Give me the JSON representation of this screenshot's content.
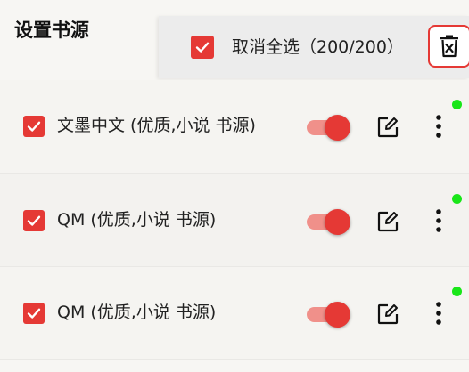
{
  "page": {
    "title": "设置书源"
  },
  "select_bar": {
    "checked": true,
    "label": "取消全选（200/200）",
    "delete_icon": "delete-icon"
  },
  "sources": [
    {
      "name": "文墨中文 (优质,小说 书源)",
      "checked": true,
      "enabled": true,
      "status": "green-dot"
    },
    {
      "name": "QM (优质,小说 书源)",
      "checked": true,
      "enabled": true,
      "status": "green-dot"
    },
    {
      "name": "QM (优质,小说 书源)",
      "checked": true,
      "enabled": true,
      "status": "green-dot"
    }
  ],
  "icons": {
    "checkbox": "check-icon",
    "edit": "edit-icon",
    "more": "more-vertical-icon"
  },
  "colors": {
    "accent": "#e53935",
    "switch_track": "#f0908a",
    "status_dot": "#19e619",
    "background": "#f7f6f3",
    "select_bar_bg": "#ececec"
  }
}
